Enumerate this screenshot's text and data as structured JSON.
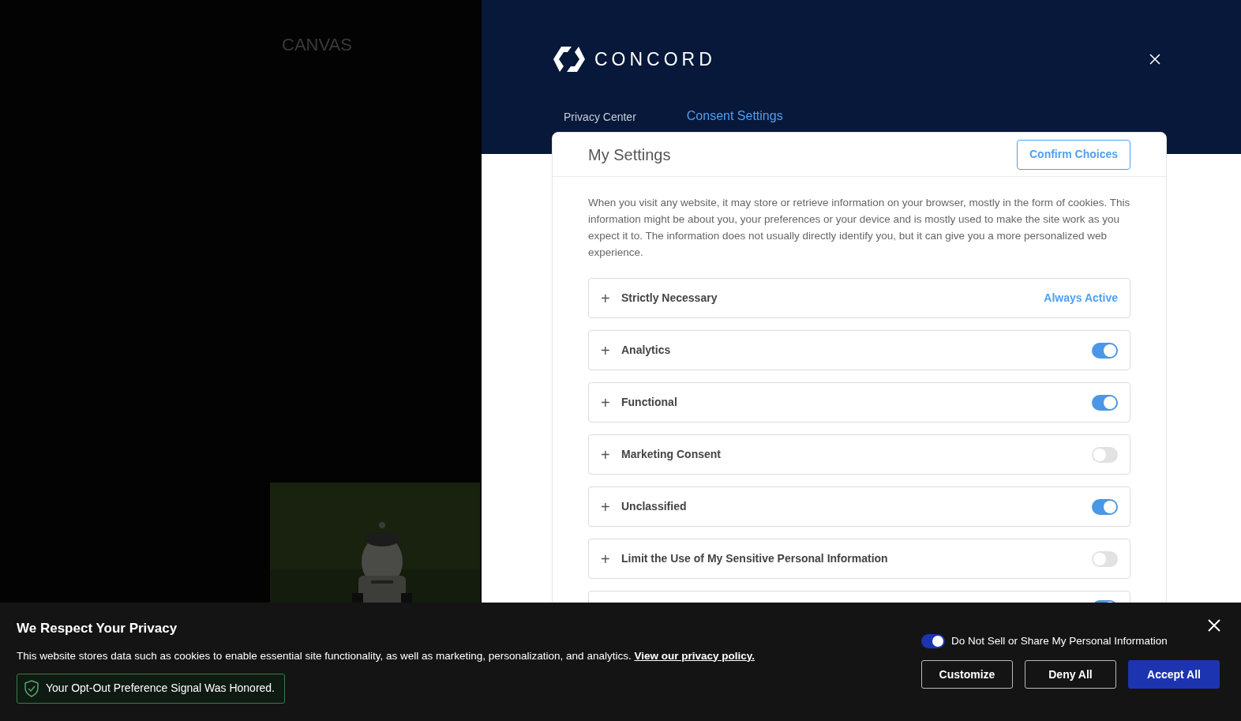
{
  "background": {
    "label": "CANVAS"
  },
  "privacy_center": {
    "brand": "CONCORD",
    "tabs": [
      {
        "label": "Privacy Center",
        "selected": false
      },
      {
        "label": "Consent Settings",
        "selected": true
      }
    ],
    "settings": {
      "title": "My Settings",
      "confirm_button": "Confirm Choices",
      "description": "When you visit any website, it may store or retrieve information on your browser, mostly in the form of cookies. This information might be about you, your preferences or your device and is mostly used to make the site work as you expect it to. The information does not usually directly identify you, but it can give you a more personalized web experience.",
      "categories": [
        {
          "kind": "status",
          "expand_icon": "+",
          "label": "Strictly Necessary",
          "status": "Always Active"
        },
        {
          "kind": "toggle",
          "expand_icon": "+",
          "label": "Analytics",
          "on": true
        },
        {
          "kind": "toggle",
          "expand_icon": "+",
          "label": "Functional",
          "on": true
        },
        {
          "kind": "toggle",
          "expand_icon": "+",
          "label": "Marketing Consent",
          "on": false
        },
        {
          "kind": "toggle",
          "expand_icon": "+",
          "label": "Unclassified",
          "on": true
        },
        {
          "kind": "toggle",
          "expand_icon": "+",
          "label": "Limit the Use of My Sensitive Personal Information",
          "on": false
        },
        {
          "kind": "toggle",
          "on": true
        }
      ]
    }
  },
  "banner": {
    "title": "We Respect Your Privacy",
    "text": "This website stores data such as cookies to enable essential site functionality, as well as marketing, personalization, and analytics.",
    "link": "View our privacy policy.",
    "notice": "Your Opt-Out Preference Signal Was Honored.",
    "do_not_sell": {
      "label": "Do Not Sell or Share My Personal Information",
      "on": true
    },
    "buttons": [
      {
        "label": "Customize",
        "kind": "outline"
      },
      {
        "label": "Deny All",
        "kind": "outline"
      },
      {
        "label": "Accept All",
        "kind": "primary"
      }
    ]
  }
}
